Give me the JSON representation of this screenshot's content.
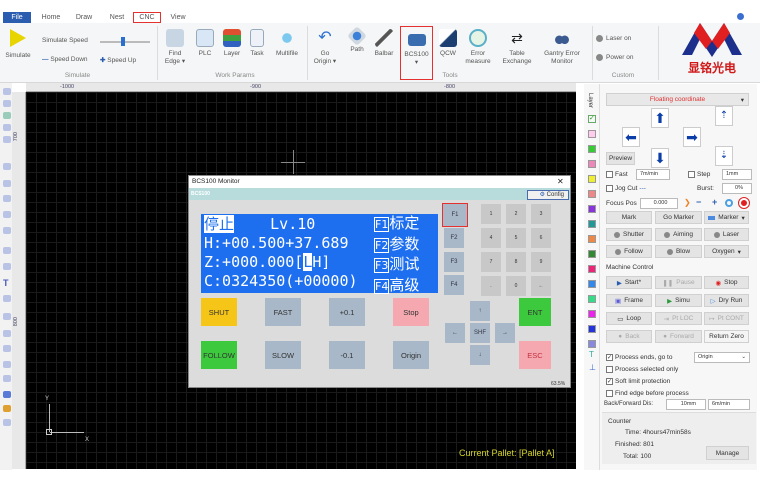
{
  "tabs": [
    {
      "label": "File",
      "active": true
    },
    {
      "label": "Home"
    },
    {
      "label": "Draw"
    },
    {
      "label": "Nest"
    },
    {
      "label": "CNC",
      "highlighted": true
    },
    {
      "label": "View"
    }
  ],
  "ribbon": {
    "simulate": {
      "group": "Simulate",
      "simulate": "Simulate",
      "speed_label": "Simulate Speed",
      "speed_value": 0.45,
      "speed_down": "Speed Down",
      "speed_up": "Speed Up"
    },
    "work_params": {
      "group": "Work Params",
      "items": [
        "Find Edge",
        "PLC",
        "Layer",
        "Task",
        "Multifile"
      ]
    },
    "tools": {
      "group": "Tools",
      "items": [
        "Go Origin",
        "Path",
        "Balbar",
        "BCS100",
        "QCW",
        "Error measure",
        "Table Exchange",
        "Gantry Error Monitor"
      ]
    },
    "custom": {
      "group": "Custom",
      "laser_on": "Laser on",
      "power_on": "Power on"
    },
    "logo_text": "显铭光电"
  },
  "rulers": {
    "top": [
      "-1000",
      "-900",
      "-800"
    ],
    "left": [
      "700",
      "800"
    ]
  },
  "layer_strip": {
    "label": "Layer",
    "colors": [
      "#33cc33",
      "#ee88bb",
      "#eeee33",
      "#ee8888",
      "#8833dd",
      "#229999",
      "#ee8844",
      "#338833",
      "#ee2277",
      "#3388ee",
      "#33dd88",
      "#ee22ee",
      "#2233dd",
      "#8888dd"
    ]
  },
  "canvas": {
    "axis_x": "X",
    "axis_y": "Y",
    "pallet": "Current Pallet: [Pallet A]",
    "pallet_color": "#d4d42a"
  },
  "dialog": {
    "title": "BCS100 Monitor",
    "close": "✕",
    "band": "BCS100",
    "config": "Config",
    "lcd": {
      "status": "停止",
      "level": "Lv.10",
      "h": "H:+00.500+37.689",
      "z": "Z:+000.000[",
      "z_cursor": "L",
      "z_end": "H]",
      "c": "C:0324350(+00000)",
      "f1": "F1",
      "f1t": "标定",
      "f2": "F2",
      "f2t": "参数",
      "f3": "F3",
      "f3t": "测试",
      "f4": "F4",
      "f4t": "高级"
    },
    "fkeys": [
      "F1",
      "F2",
      "F3",
      "F4"
    ],
    "numpad": [
      "1",
      "2",
      "3",
      "4",
      "5",
      "6",
      "7",
      "8",
      "9",
      ".",
      "0",
      "←"
    ],
    "buttons": {
      "shut": "SHUT",
      "fast": "FAST",
      "plus": "+0.1",
      "stop": "Stop",
      "follow": "FOLLOW",
      "slow": "SLOW",
      "minus": "-0.1",
      "origin": "Origin",
      "ent": "ENT",
      "esc": "ESC",
      "shf": "SHF",
      "up": "↑",
      "down": "↓",
      "left": "←",
      "right": "→"
    },
    "footer": "63.5%"
  },
  "panel": {
    "coord_mode": "Floating coordinate",
    "preview": "Preview",
    "fast": "Fast",
    "fast_speed": "7m/min",
    "step": "Step",
    "step_value": "1mm",
    "jog_cut": "Jog Cut",
    "jog_cut_value": "---",
    "burst": "Burst:",
    "burst_value": "0%",
    "focus_pos": "Focus Pos",
    "focus_value": "0.000",
    "mark": "Mark",
    "go_marker": "Go Marker",
    "marker": "Marker",
    "shutter": "Shutter",
    "aiming": "Aiming",
    "laser": "Laser",
    "follow": "Follow",
    "blow": "Blow",
    "oxygen": "Oxygen",
    "machine_control": "Machine Control",
    "start": "Start*",
    "pause": "Pause",
    "stop": "Stop",
    "frame": "Frame",
    "simu": "Simu",
    "dry_run": "Dry Run",
    "loop": "Loop",
    "pt_loc": "Pt LOC",
    "pt_cont": "Pt CONT",
    "back": "Back",
    "forward": "Forward",
    "return_zero": "Return Zero",
    "process_ends": "Process ends, go to",
    "process_ends_checked": true,
    "process_ends_target": "Origin",
    "process_selected": "Process selected only",
    "process_selected_checked": false,
    "soft_limit": "Soft limit protection",
    "soft_limit_checked": true,
    "find_edge": "Find edge before process",
    "find_edge_checked": false,
    "back_forward": "Back/Forward Dis:",
    "bf_dist": "10mm",
    "bf_speed": "6m/min",
    "counter": "Counter",
    "time": "Time: 4hours47min58s",
    "finished": "Finished: 801",
    "total": "Total: 100",
    "manage": "Manage"
  },
  "highlight_color": "#e53030"
}
